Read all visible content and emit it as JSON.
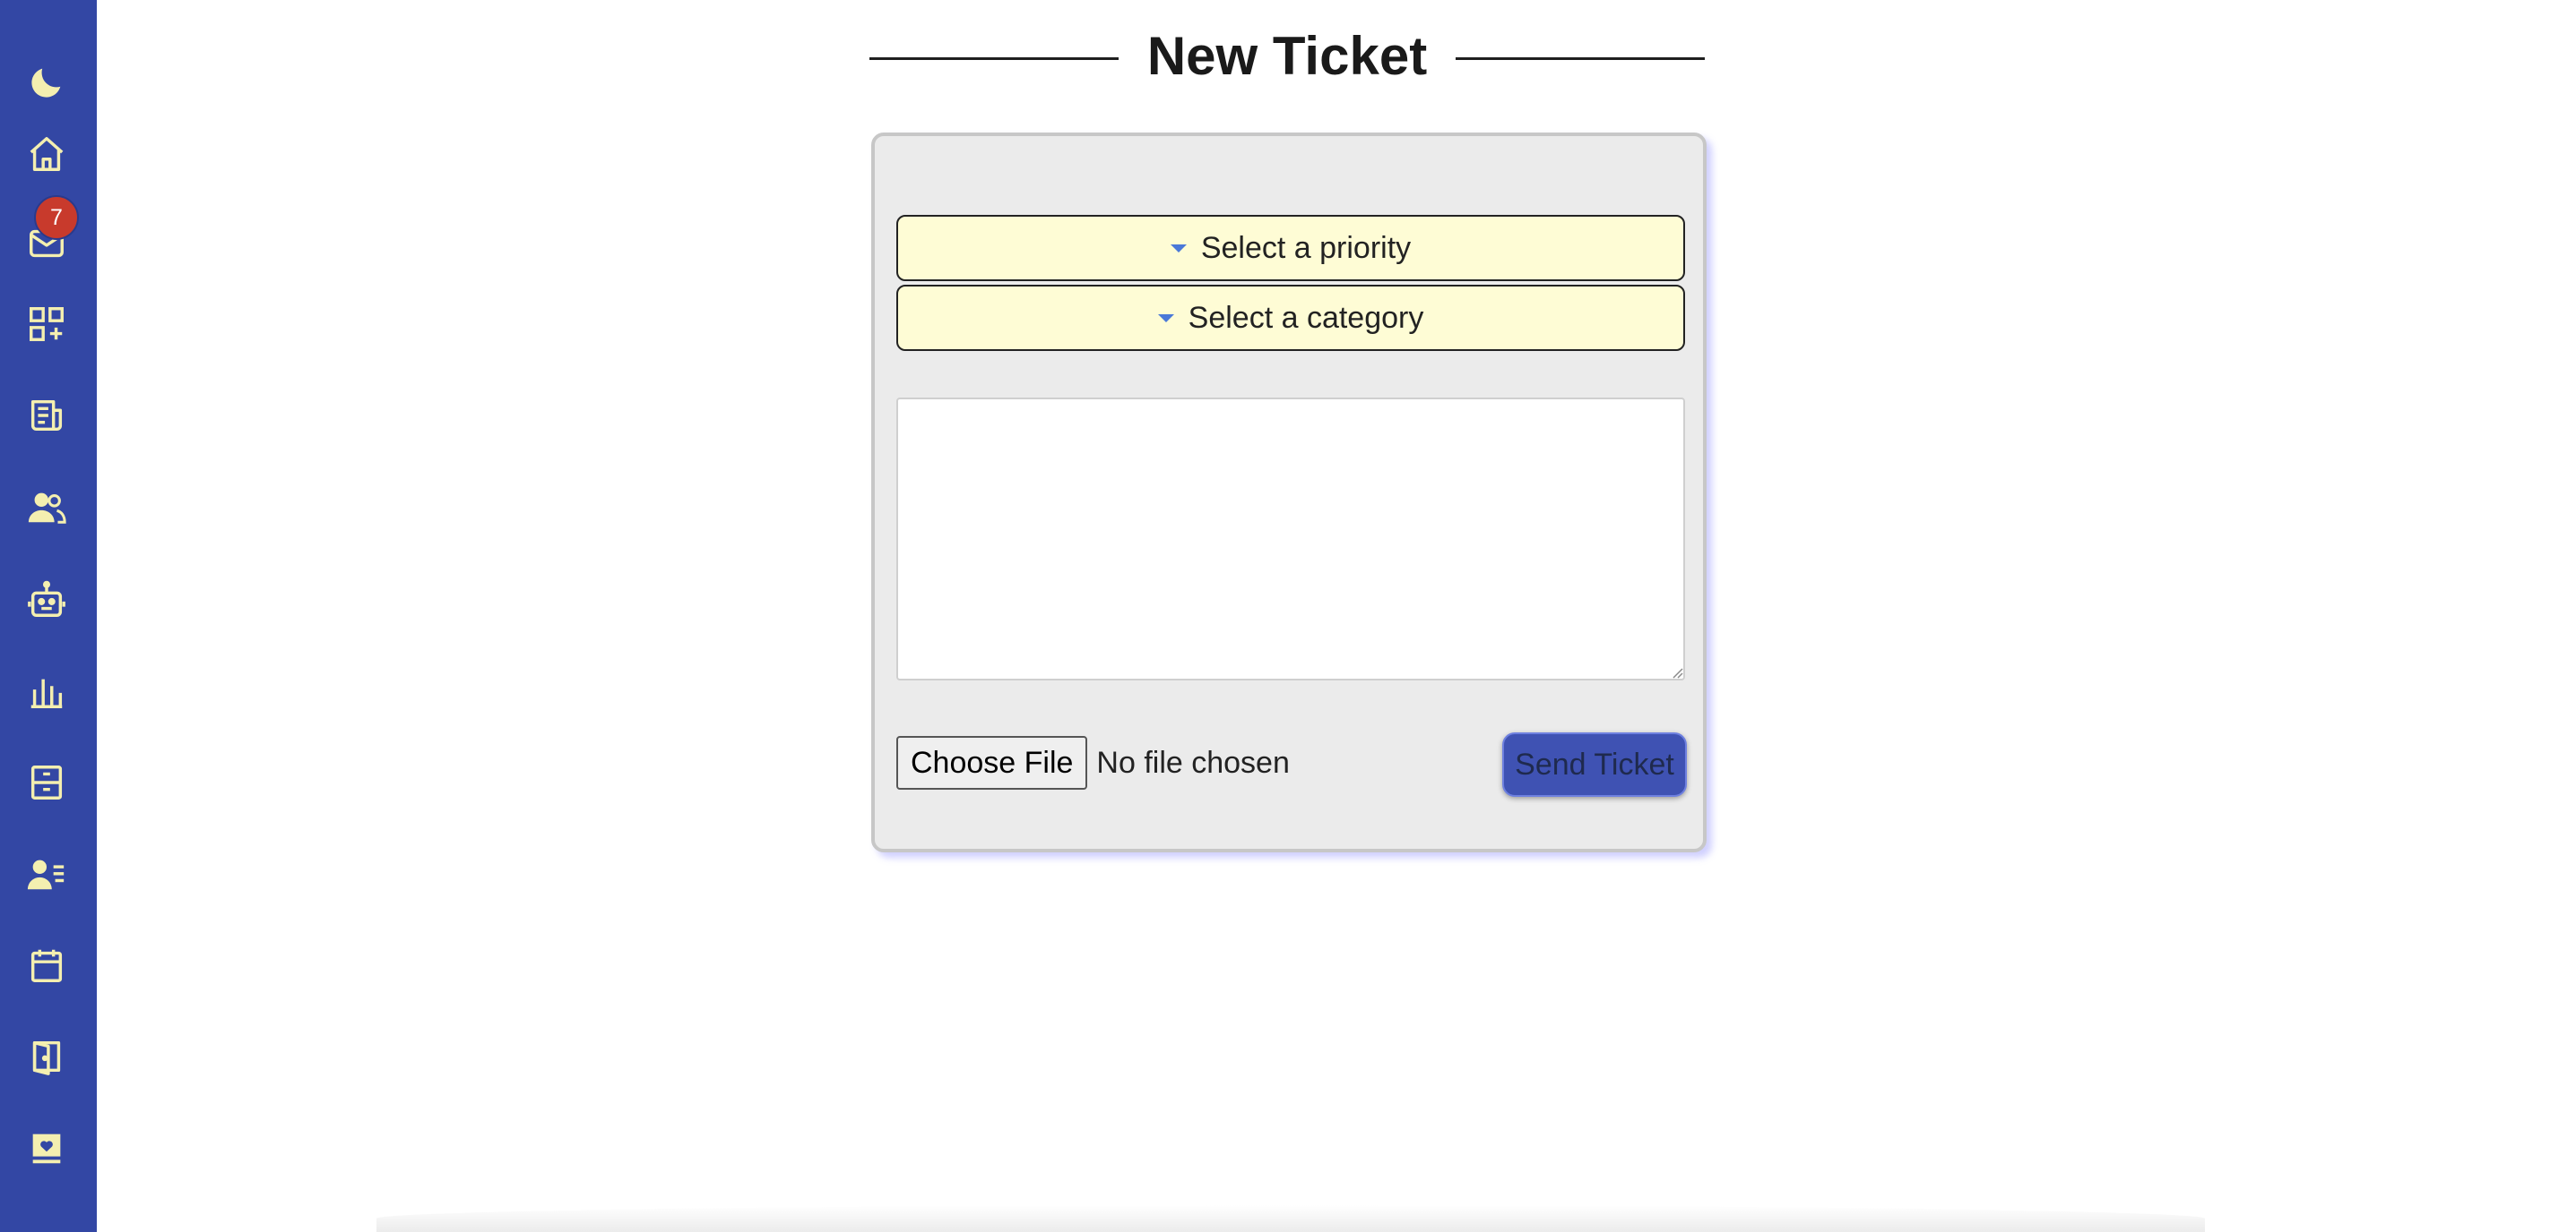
{
  "sidebar": {
    "colors": {
      "background": "#3347a4",
      "icon": "#f4efb0",
      "badge": "#c83a2c"
    },
    "items": [
      {
        "icon": "moon-icon"
      },
      {
        "icon": "home-icon"
      },
      {
        "icon": "mail-icon",
        "badge": "7"
      },
      {
        "icon": "apps-add-icon"
      },
      {
        "icon": "news-icon"
      },
      {
        "icon": "users-icon"
      },
      {
        "icon": "robot-icon"
      },
      {
        "icon": "chart-bars-icon"
      },
      {
        "icon": "archive-icon"
      },
      {
        "icon": "user-list-icon"
      },
      {
        "icon": "calendar-icon"
      },
      {
        "icon": "door-exit-icon"
      },
      {
        "icon": "heart-book-icon"
      }
    ]
  },
  "page": {
    "title": "New Ticket"
  },
  "form": {
    "priority_placeholder": "Select a priority",
    "category_placeholder": "Select a category",
    "message_value": "",
    "choose_file_label": "Choose File",
    "file_status": "No file chosen",
    "send_label": "Send Ticket"
  },
  "colors": {
    "select_background": "#fefcd5",
    "card_background": "#ebebeb",
    "send_button": "#3f52b3",
    "caret": "#4a78d8"
  }
}
